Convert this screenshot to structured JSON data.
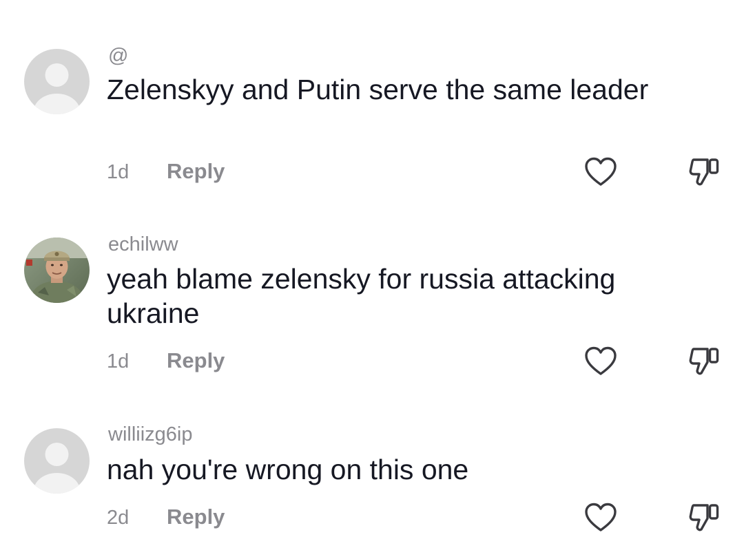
{
  "comments": [
    {
      "username": "@",
      "text": "Zelenskyy and Putin serve the same leader",
      "time": "1d",
      "reply_label": "Reply",
      "avatar": "default-avatar"
    },
    {
      "username": "echilww",
      "text": "yeah blame zelensky for russia attacking ukraine",
      "time": "1d",
      "reply_label": "Reply",
      "avatar": "photo-avatar"
    },
    {
      "username": "williizg6ip",
      "text": "nah you're wrong on this one",
      "time": "2d",
      "reply_label": "Reply",
      "avatar": "default-avatar"
    }
  ],
  "icons": {
    "like": "heart-icon",
    "dislike": "thumbs-down-icon"
  },
  "colors": {
    "text": "#161823",
    "secondary": "#8a8a8f",
    "icon": "#3a3a3f",
    "avatar_bg": "#d9d9d9"
  }
}
